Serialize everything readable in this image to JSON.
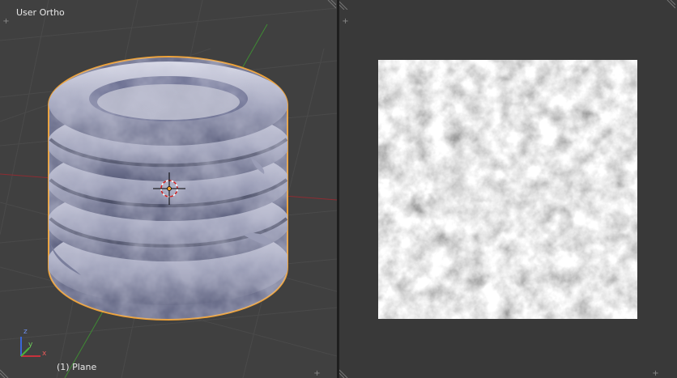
{
  "viewport3d": {
    "view_title": "User Ortho",
    "active_object": "(1) Plane",
    "axis_gizmo": {
      "x": "x",
      "y": "y",
      "z": "z"
    },
    "colors": {
      "x_axis": "#c8323c",
      "y_axis": "#4cb23a",
      "z_axis": "#3a66d8",
      "selection_outline": "#f0a030",
      "background": "#404040"
    }
  },
  "image_editor": {
    "texture": "noise-texture",
    "colors": {
      "background": "#393939"
    }
  },
  "icons": [
    "corner-plus-icon",
    "corner-hatch-icon",
    "3d-cursor-icon",
    "axis-gizmo-icon"
  ]
}
